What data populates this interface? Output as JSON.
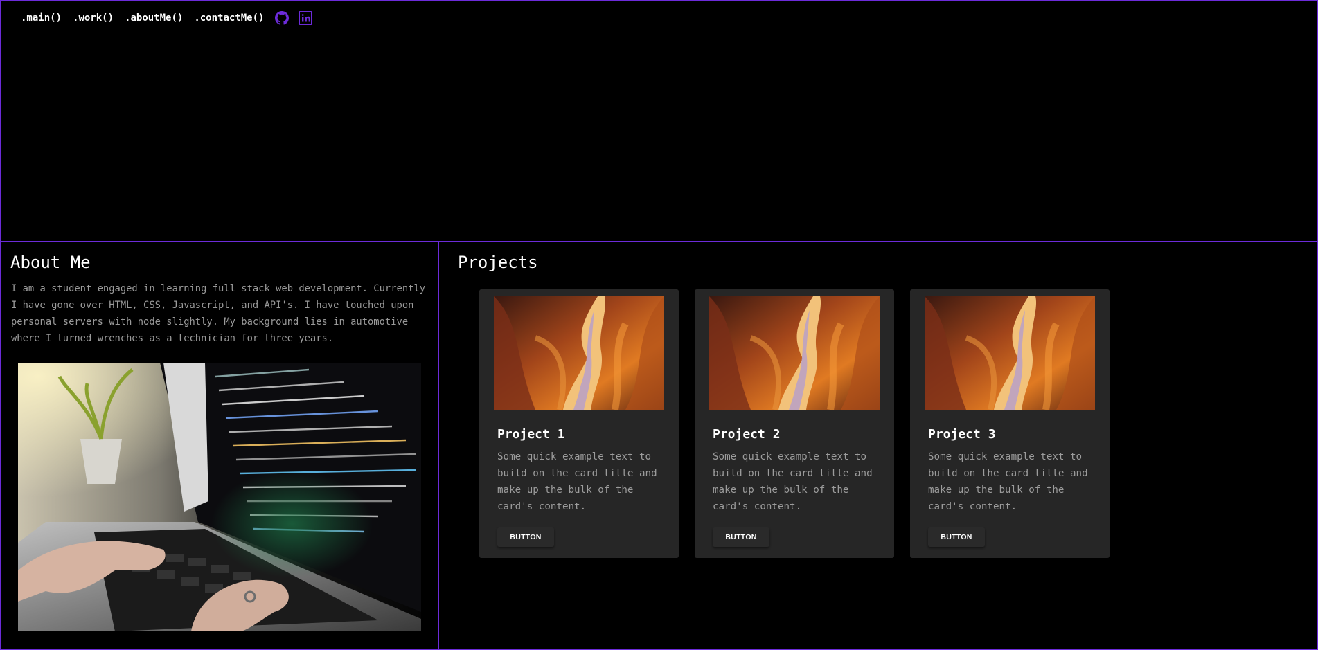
{
  "nav": {
    "links": [
      ".main()",
      ".work()",
      ".aboutMe()",
      ".contactMe()"
    ],
    "icons": [
      "github-icon",
      "linkedin-icon"
    ],
    "icon_color": "#6c2bd9"
  },
  "about": {
    "title": "About Me",
    "text": "I am a student engaged in learning full stack web development. Currently I have gone over HTML, CSS, Javascript, and API's. I have touched upon personal servers with node slightly. My background lies in automotive where I turned wrenches as a technician for three years."
  },
  "projects": {
    "title": "Projects",
    "cards": [
      {
        "title": "Project 1",
        "text": "Some quick example text to build on the card title and make up the bulk of the card's content.",
        "button": "BUTTON"
      },
      {
        "title": "Project 2",
        "text": "Some quick example text to build on the card title and make up the bulk of the card's content.",
        "button": "BUTTON"
      },
      {
        "title": "Project 3",
        "text": "Some quick example text to build on the card title and make up the bulk of the card's content.",
        "button": "BUTTON"
      }
    ]
  },
  "colors": {
    "accent": "#6c2bd9",
    "background": "#000000",
    "card": "#262626",
    "muted_text": "#9a9a9a"
  }
}
